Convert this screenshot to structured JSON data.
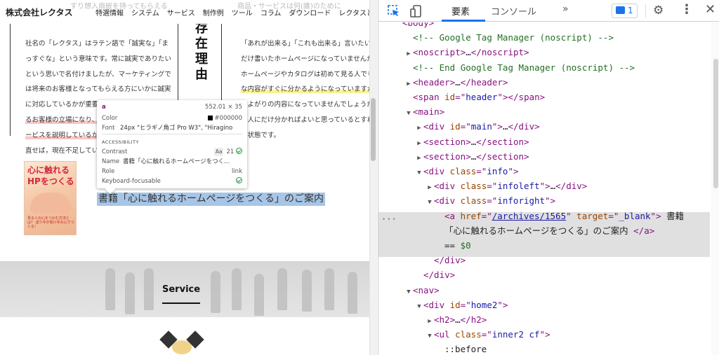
{
  "site": {
    "logo": "株式会社レクタス",
    "ghost_text_left": "すり想入扇嵌を持ってもらえる",
    "ghost_text_right": "商品・サービスは何(誰)のために",
    "nav": [
      "特選情報",
      "システム",
      "サービス",
      "制作例",
      "ツール",
      "コラム",
      "ダウンロード",
      "レクタスと"
    ],
    "vertical_title": "存在理由",
    "left_paragraph": [
      "社名の「レクタス」はラテン語で「誠実な」「ま",
      "っすぐな」という意味です。常に誠実でありたい",
      "という思いで名付けましたが、マーケティングで",
      "は将来のお客様となってもらえる方にいかに誠実",
      "に対応しているかが重要です。御社に接してくれ",
      "るお客様の立場になり、ど",
      "ービスを説明しているか、",
      "直せば，現在不足している"
    ],
    "right_paragraph": [
      "「あれが出来る」「これも出来る」言いたい",
      "だけ書いたホームページになっていませんか？",
      "ホームページやカタログは初めて見る人でもど",
      "な内容がすぐに分かるようになっていますか？",
      "りよがりの内容になっていませんでしょうか？",
      "る人にだけ分かればよいと思っているとすれ",
      "な状態です。",
      ""
    ],
    "book_title": "心に触れるHPをつくる",
    "book_subtitle": "見る人の心をつかむ方法とは？ 送り手が受け手の心でつくる！",
    "selected_link_text": "書籍「心に触れるホームページをつくる」のご案内",
    "service_title": "Service"
  },
  "tooltip": {
    "tag": "a",
    "size": "552.01 × 35",
    "color_label": "Color",
    "color_value": "#000000",
    "font_label": "Font",
    "font_value": "24px \"ヒラギノ角ゴ Pro W3\", \"Hiragino",
    "accessibility_header": "ACCESSIBILITY",
    "contrast_label": "Contrast",
    "contrast_badge": "Aa",
    "contrast_value": "21",
    "name_label": "Name",
    "name_value": "書籍「心に触れるホームページをつく...",
    "role_label": "Role",
    "role_value": "link",
    "keyboard_label": "Keyboard-focusable"
  },
  "devtools": {
    "tab_elements": "要素",
    "tab_console": "コンソール",
    "more_tabs": "»",
    "issues_count": "1",
    "dom": [
      {
        "indent": 2,
        "tri": "",
        "parts": [
          [
            "tag",
            "<body>"
          ]
        ]
      },
      {
        "indent": 3,
        "tri": "",
        "parts": [
          [
            "cm",
            "<!-- Google Tag Manager (noscript) -->"
          ]
        ]
      },
      {
        "indent": 3,
        "tri": "▶",
        "parts": [
          [
            "tag",
            "<noscript>"
          ],
          [
            "txt",
            "…"
          ],
          [
            "tag",
            "</noscript>"
          ]
        ]
      },
      {
        "indent": 3,
        "tri": "",
        "parts": [
          [
            "cm",
            "<!-- End Google Tag Manager (noscript) -->"
          ]
        ]
      },
      {
        "indent": 3,
        "tri": "▶",
        "parts": [
          [
            "tag",
            "<header>"
          ],
          [
            "txt",
            "…"
          ],
          [
            "tag",
            "</header>"
          ]
        ]
      },
      {
        "indent": 3,
        "tri": "",
        "parts": [
          [
            "tag",
            "<span "
          ],
          [
            "an",
            "id"
          ],
          [
            "tag",
            "=\""
          ],
          [
            "av",
            "header"
          ],
          [
            "tag",
            "\"></span>"
          ]
        ]
      },
      {
        "indent": 3,
        "tri": "▼",
        "parts": [
          [
            "tag",
            "<main>"
          ]
        ]
      },
      {
        "indent": 4,
        "tri": "▶",
        "parts": [
          [
            "tag",
            "<div "
          ],
          [
            "an",
            "id"
          ],
          [
            "tag",
            "=\""
          ],
          [
            "av",
            "main"
          ],
          [
            "tag",
            "\">"
          ],
          [
            "txt",
            "…"
          ],
          [
            "tag",
            "</div>"
          ]
        ]
      },
      {
        "indent": 4,
        "tri": "▶",
        "parts": [
          [
            "tag",
            "<section>"
          ],
          [
            "txt",
            "…"
          ],
          [
            "tag",
            "</section>"
          ]
        ]
      },
      {
        "indent": 4,
        "tri": "▶",
        "parts": [
          [
            "tag",
            "<section>"
          ],
          [
            "txt",
            "…"
          ],
          [
            "tag",
            "</section>"
          ]
        ]
      },
      {
        "indent": 4,
        "tri": "▼",
        "parts": [
          [
            "tag",
            "<div "
          ],
          [
            "an",
            "class"
          ],
          [
            "tag",
            "=\""
          ],
          [
            "av",
            "info"
          ],
          [
            "tag",
            "\">"
          ]
        ]
      },
      {
        "indent": 5,
        "tri": "▶",
        "parts": [
          [
            "tag",
            "<div "
          ],
          [
            "an",
            "class"
          ],
          [
            "tag",
            "=\""
          ],
          [
            "av",
            "infoleft"
          ],
          [
            "tag",
            "\">"
          ],
          [
            "txt",
            "…"
          ],
          [
            "tag",
            "</div>"
          ]
        ]
      },
      {
        "indent": 5,
        "tri": "▼",
        "parts": [
          [
            "tag",
            "<div "
          ],
          [
            "an",
            "class"
          ],
          [
            "tag",
            "=\""
          ],
          [
            "av",
            "inforight"
          ],
          [
            "tag",
            "\">"
          ]
        ]
      },
      {
        "indent": 6,
        "tri": "",
        "parts": [
          [
            "tag",
            "<a "
          ],
          [
            "an",
            "href"
          ],
          [
            "tag",
            "=\""
          ],
          [
            "link",
            "/archives/1565"
          ],
          [
            "tag",
            "\" "
          ],
          [
            "an",
            "target"
          ],
          [
            "tag",
            "=\""
          ],
          [
            "av",
            "_blank"
          ],
          [
            "tag",
            "\">"
          ],
          [
            "txt",
            " 書籍"
          ]
        ]
      },
      {
        "indent": 6,
        "tri": "",
        "parts": [
          [
            "txt",
            "「心に触れるホームページをつくる」のご案内 "
          ],
          [
            "tag",
            "</a>"
          ]
        ]
      },
      {
        "indent": 6,
        "tri": "",
        "parts": [
          [
            "txt",
            "== "
          ],
          [
            "cm",
            "$0"
          ]
        ]
      },
      {
        "indent": 5,
        "tri": "",
        "parts": [
          [
            "tag",
            "</div>"
          ]
        ]
      },
      {
        "indent": 4,
        "tri": "",
        "parts": [
          [
            "tag",
            "</div>"
          ]
        ]
      },
      {
        "indent": 3,
        "tri": "▼",
        "parts": [
          [
            "tag",
            "<nav>"
          ]
        ]
      },
      {
        "indent": 4,
        "tri": "▼",
        "parts": [
          [
            "tag",
            "<div "
          ],
          [
            "an",
            "id"
          ],
          [
            "tag",
            "=\""
          ],
          [
            "av",
            "home2"
          ],
          [
            "tag",
            "\">"
          ]
        ]
      },
      {
        "indent": 5,
        "tri": "▶",
        "parts": [
          [
            "tag",
            "<h2>"
          ],
          [
            "txt",
            "…"
          ],
          [
            "tag",
            "</h2>"
          ]
        ]
      },
      {
        "indent": 5,
        "tri": "▼",
        "parts": [
          [
            "tag",
            "<ul "
          ],
          [
            "an",
            "class"
          ],
          [
            "tag",
            "=\""
          ],
          [
            "av",
            "inner2 cf"
          ],
          [
            "tag",
            "\">"
          ]
        ]
      },
      {
        "indent": 6,
        "tri": "",
        "parts": [
          [
            "txt",
            "::before"
          ]
        ]
      }
    ]
  },
  "colors": {
    "accent": "#1a73e8",
    "selection": "#a7c5e6",
    "tag": "#881280",
    "attr_name": "#994500",
    "attr_value": "#1a1aa6",
    "comment": "#236e25"
  }
}
